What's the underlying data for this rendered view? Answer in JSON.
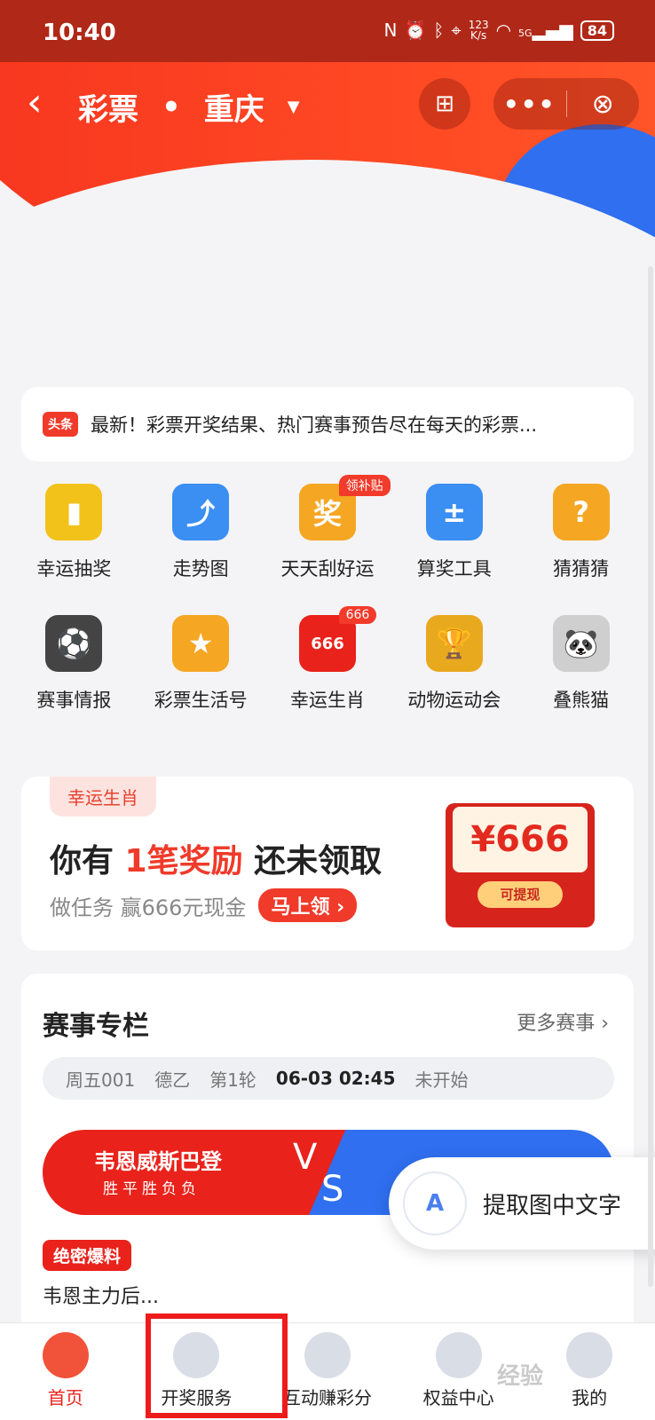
{
  "status_bar": {
    "time": "10:40",
    "speed": "123\nK/s",
    "network": "5G",
    "battery": "84"
  },
  "nav": {
    "title": "彩票",
    "location": "重庆",
    "back_icon": "chevron-left-icon",
    "more_label": "•••"
  },
  "news": {
    "tag": "头条",
    "text": "最新！彩票开奖结果、热门赛事预告尽在每天的彩票..."
  },
  "grid": [
    {
      "label": "幸运抽奖",
      "icon": "lucky-draw-icon",
      "color": "#f2c21b",
      "glyph": "▮"
    },
    {
      "label": "走势图",
      "icon": "trend-chart-icon",
      "color": "#3b8ef2",
      "glyph": "⤴"
    },
    {
      "label": "天天刮好运",
      "icon": "scratch-card-icon",
      "color": "#f5a623",
      "glyph": "奖",
      "badge": "领补贴"
    },
    {
      "label": "算奖工具",
      "icon": "calculator-icon",
      "color": "#3b8ef2",
      "glyph": "±"
    },
    {
      "label": "猜猜猜",
      "icon": "question-icon",
      "color": "#f5a623",
      "glyph": "?"
    },
    {
      "label": "赛事情报",
      "icon": "soccer-ball-icon",
      "color": "#444444",
      "glyph": "⚽"
    },
    {
      "label": "彩票生活号",
      "icon": "star-bookmark-icon",
      "color": "#f5a623",
      "glyph": "★"
    },
    {
      "label": "幸运生肖",
      "icon": "red-envelope-icon",
      "color": "#e9221b",
      "glyph": "666",
      "badge": "666"
    },
    {
      "label": "动物运动会",
      "icon": "trophy-icon",
      "color": "#e9a91f",
      "glyph": "🏆"
    },
    {
      "label": "叠熊猫",
      "icon": "panda-icon",
      "color": "#cfcfcf",
      "glyph": "🐼"
    }
  ],
  "promo": {
    "tag": "幸运生肖",
    "title_pre": "你有 ",
    "title_hl": "1笔奖励",
    "title_post": " 还未领取",
    "subtitle": "做任务 赢666元现金",
    "button": "马上领 ›",
    "amount": "¥666",
    "withdraw": "可提现"
  },
  "match": {
    "title": "赛事专栏",
    "more": "更多赛事 ›",
    "code": "周五001",
    "league": "德乙",
    "round": "第1轮",
    "datetime": "06-03 02:45",
    "state": "未开始",
    "home_team": "韦恩威斯巴登",
    "home_record": "胜平胜负负",
    "v": "V",
    "s": "S",
    "secret_tag": "绝密爆料",
    "secret_text": "韦恩主力后..."
  },
  "ocr": {
    "label": "提取图中文字",
    "icon_text": "A"
  },
  "tabs": [
    {
      "label": "首页",
      "icon": "home-mascot-icon",
      "active": true
    },
    {
      "label": "开奖服务",
      "icon": "crystal-ball-icon",
      "active": false
    },
    {
      "label": "互动赚彩分",
      "icon": "planet-icon",
      "active": false
    },
    {
      "label": "权益中心",
      "icon": "clover-icon",
      "active": false
    },
    {
      "label": "我的",
      "icon": "user-icon",
      "active": false
    }
  ],
  "colors": {
    "brand_red": "#f03a2a",
    "brand_blue": "#2f6ff0"
  }
}
